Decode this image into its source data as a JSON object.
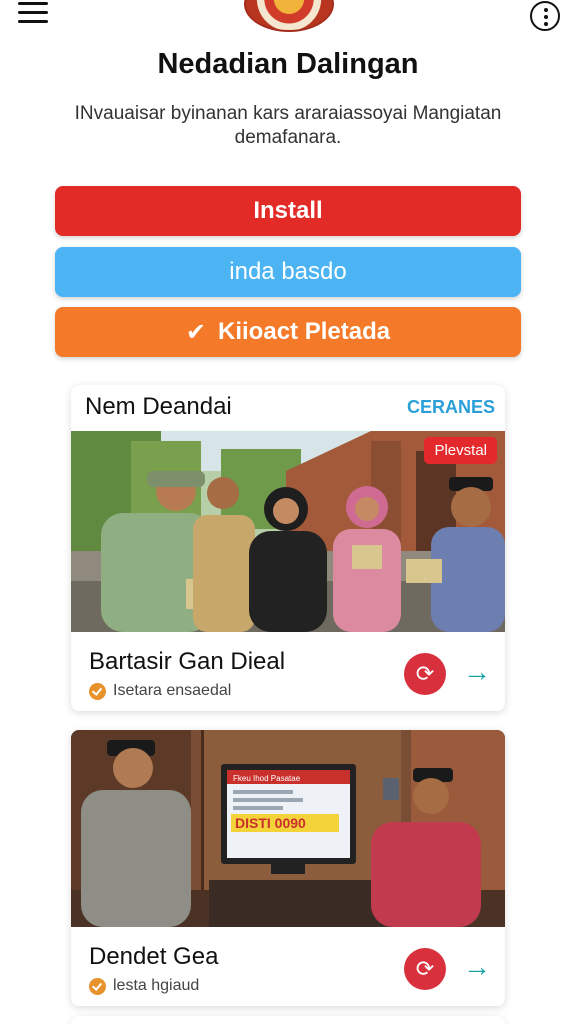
{
  "header": {
    "title": "Nedadian Dalingan",
    "subtitle": "INvauaisar byinanan kars araraiassoyai Mangiatan demafanara.",
    "icons": [
      "menu-icon",
      "emblem-logo",
      "more-icon"
    ]
  },
  "buttons": {
    "install": "Install",
    "secondary": "inda basdo",
    "tertiary": "Kiioact Pletada"
  },
  "section": {
    "heading": "Nem Deandai",
    "link": "CERANES"
  },
  "cards": [
    {
      "badge": "Plevstal",
      "title": "Bartasir Gan Dieal",
      "meta": "Isetara ensaedal"
    },
    {
      "tv_text_top": "Fkeu Ihod Pasatae",
      "tv_text_big": "DISTI 0090",
      "title": "Dendet Gea",
      "meta": "lesta hgiaud"
    }
  ],
  "colors": {
    "install": "#e22a27",
    "secondary": "#4db4f4",
    "tertiary": "#f47a2a",
    "link": "#2a9fd8",
    "badge": "#e3292c",
    "refresh": "#d8313d",
    "arrow": "#1aa5a5"
  }
}
